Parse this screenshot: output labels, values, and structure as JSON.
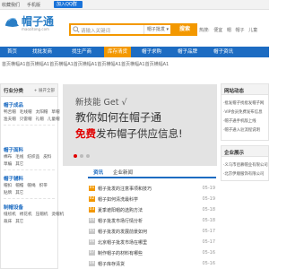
{
  "topbar": {
    "favorite": "收藏我们",
    "mobile": "手机版",
    "qq": "加入QQ群"
  },
  "header": {
    "logo_title": "帽子通",
    "logo_sub": "maozitong.com",
    "search_placeholder": "请输入关键词",
    "search_scope": "帽子批发",
    "search_button": "搜索",
    "hot_label": "热搜:",
    "hot_terms": [
      "便宜",
      "帽",
      "帽子",
      "儿童"
    ]
  },
  "nav": {
    "tabs": [
      "首页",
      "找批发商",
      "找生产商",
      "库存清货",
      "帽子求购",
      "帽子品牌",
      "帽子资讯"
    ],
    "active_index": 3
  },
  "breadcrumb": "首页横幅A1首页横幅A1首页横幅A1首页横幅A1首页横幅A1首页横幅A1首页横幅A1",
  "sidebar": {
    "title": "行业分类",
    "expand": "+ 展开全部",
    "groups": [
      {
        "title": "帽子成品",
        "rows": [
          [
            "鸭舌帽",
            "毛线帽",
            "太阳帽",
            "草帽"
          ],
          [
            "渔夫帽",
            "贝雷帽",
            "礼帽",
            "儿童帽"
          ]
        ]
      },
      {
        "title": "帽子面料",
        "rows": [
          [
            "棉布",
            "毛线",
            "纺织品",
            "皮料"
          ],
          [
            "草编",
            "其它"
          ]
        ]
      },
      {
        "title": "帽子辅料",
        "rows": [
          [
            "帽扣",
            "帽檐",
            "帽绳",
            "织带"
          ],
          [
            "贴牌",
            "其它"
          ]
        ]
      },
      {
        "title": "制帽设备",
        "rows": [
          [
            "缝纫机",
            "绣花机",
            "压帽机",
            "烫帽机"
          ],
          [
            "裁床",
            "其它"
          ]
        ]
      }
    ]
  },
  "banner": {
    "line1": "新技能 Get √",
    "line2": "教你如何在帽子通",
    "line3_highlight": "免费",
    "line3_rest": "发布帽子供应信息!"
  },
  "news": {
    "tabs": [
      "资讯",
      "企业新闻"
    ],
    "active_tab": 0,
    "items": [
      {
        "num": "01",
        "title": "帽子批发的注意事项和技巧",
        "date": "05-19"
      },
      {
        "num": "02",
        "title": "帽子如何清洗最科学",
        "date": "05-19"
      },
      {
        "num": "03",
        "title": "夏季遮阳帽的选购方法",
        "date": "05-18"
      },
      {
        "num": "04",
        "title": "帽子批发市场行情分析",
        "date": "05-18"
      },
      {
        "num": "05",
        "title": "帽子批发的发展前景如何",
        "date": "05-17"
      },
      {
        "num": "06",
        "title": "北京帽子批发市场在哪里",
        "date": "05-17"
      },
      {
        "num": "07",
        "title": "制作帽子的材料有哪些",
        "date": "05-16"
      },
      {
        "num": "08",
        "title": "帽子库存清货",
        "date": "05-16"
      }
    ]
  },
  "right": {
    "notice_title": "网站动态",
    "notice_items": [
      "·批发帽子找批发帽子网",
      "·VIP会员免费发布信息",
      "·帽子通手机版上线",
      "·帽子通入驻流程说明"
    ],
    "enterprise_title": "企业展示",
    "enterprise_items": [
      "·义乌市佰慕帽业有限公司",
      "·北京伊顺服饰有限公司"
    ]
  }
}
